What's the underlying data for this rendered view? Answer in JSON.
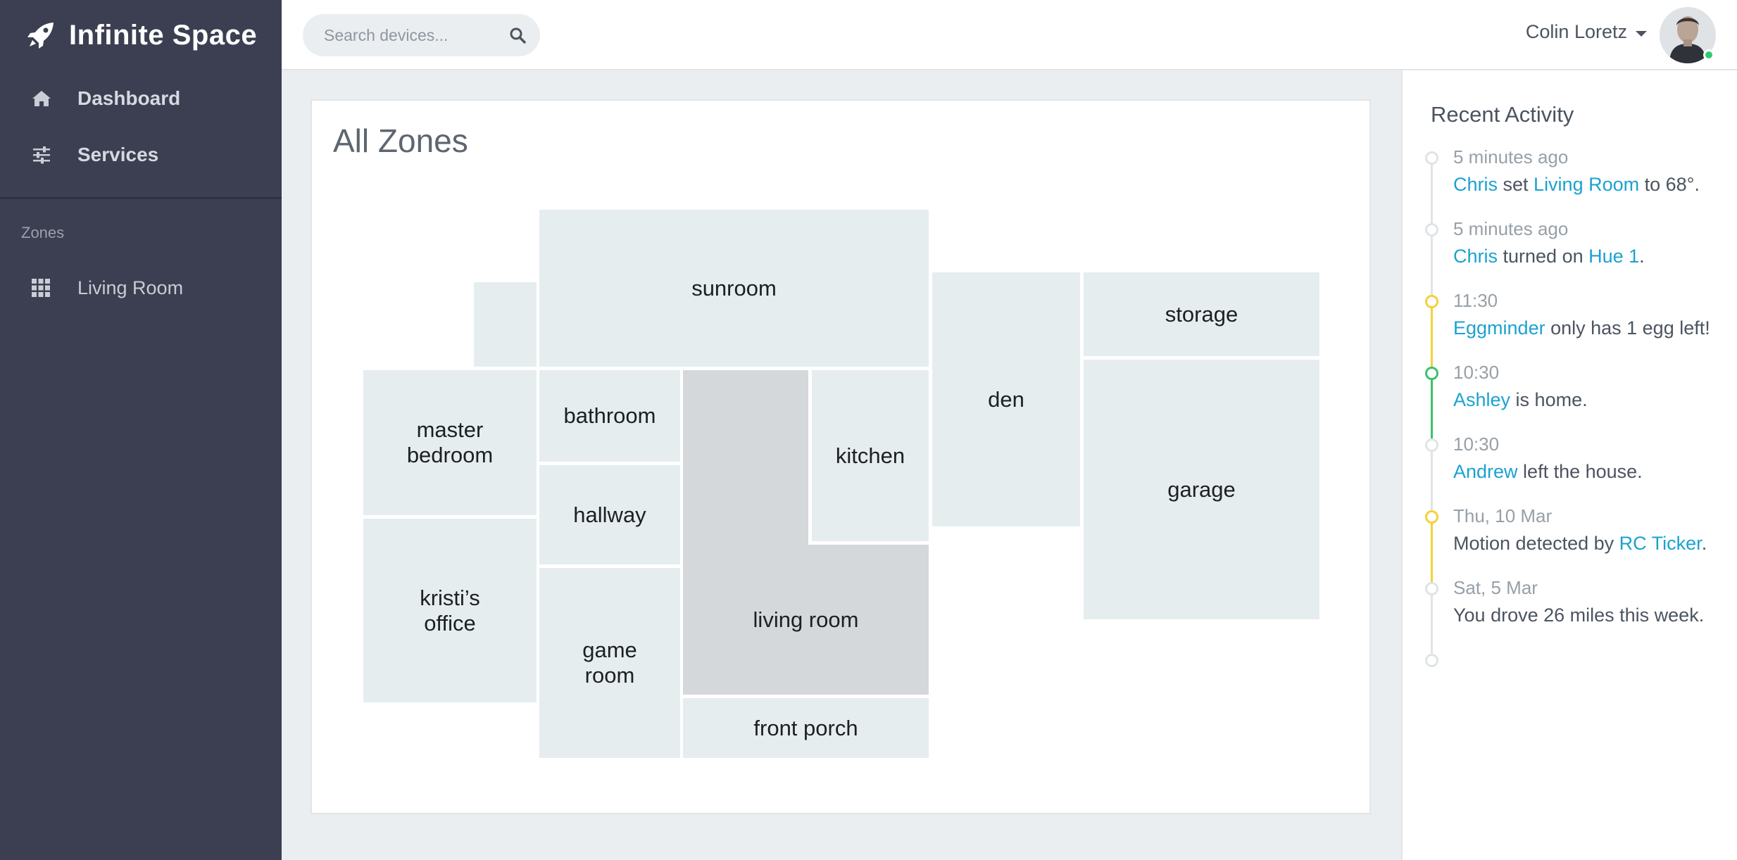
{
  "app": {
    "name": "Infinite Space"
  },
  "nav": {
    "items": [
      {
        "label": "Dashboard",
        "icon": "home-icon"
      },
      {
        "label": "Services",
        "icon": "sliders-icon"
      }
    ]
  },
  "zones": {
    "heading": "Zones",
    "items": [
      {
        "label": "Living Room",
        "icon": "grid-icon"
      }
    ]
  },
  "search": {
    "placeholder": "Search devices..."
  },
  "user": {
    "name": "Colin Loretz",
    "online": true
  },
  "floorplan": {
    "title": "All Zones",
    "rooms": {
      "sunroom": "sunroom",
      "master_bedroom_1": "master",
      "master_bedroom_2": "bedroom",
      "bathroom": "bathroom",
      "hallway": "hallway",
      "kitchen": "kitchen",
      "den": "den",
      "storage": "storage",
      "garage": "garage",
      "kristis_office_1": "kristi’s",
      "kristis_office_2": "office",
      "game_room_1": "game",
      "game_room_2": "room",
      "living_room": "living room",
      "front_porch": "front porch"
    },
    "active_room": "living room"
  },
  "activity": {
    "title": "Recent Activity",
    "entries": [
      {
        "time": "5 minutes ago",
        "dot": "grey",
        "parts": [
          {
            "t": "Chris",
            "link": true
          },
          {
            "t": " set "
          },
          {
            "t": "Living Room",
            "link": true
          },
          {
            "t": " to 68°."
          }
        ]
      },
      {
        "time": "5 minutes ago",
        "dot": "grey",
        "parts": [
          {
            "t": "Chris",
            "link": true
          },
          {
            "t": " turned on "
          },
          {
            "t": "Hue 1",
            "link": true
          },
          {
            "t": "."
          }
        ]
      },
      {
        "time": "11:30",
        "dot": "yellow",
        "parts": [
          {
            "t": "Eggminder",
            "link": true
          },
          {
            "t": " only has 1 egg left!"
          }
        ]
      },
      {
        "time": "10:30",
        "dot": "green",
        "parts": [
          {
            "t": "Ashley",
            "link": true
          },
          {
            "t": " is home."
          }
        ]
      },
      {
        "time": "10:30",
        "dot": "grey",
        "parts": [
          {
            "t": "Andrew",
            "link": true
          },
          {
            "t": " left the house."
          }
        ]
      },
      {
        "time": "Thu, 10 Mar",
        "dot": "yellow",
        "parts": [
          {
            "t": "Motion detected by "
          },
          {
            "t": "RC Ticker",
            "link": true
          },
          {
            "t": "."
          }
        ]
      },
      {
        "time": "Sat, 5 Mar",
        "dot": "grey",
        "parts": [
          {
            "t": "You drove 26 miles this week."
          }
        ]
      }
    ]
  },
  "colors": {
    "sidebar": "#3b3f51",
    "link": "#1ba2d0",
    "room": "#e6edef",
    "active_room": "#d4d8da",
    "dot_grey": "#e0e4e6",
    "dot_yellow": "#f5d13a",
    "dot_green": "#3cc26a"
  }
}
